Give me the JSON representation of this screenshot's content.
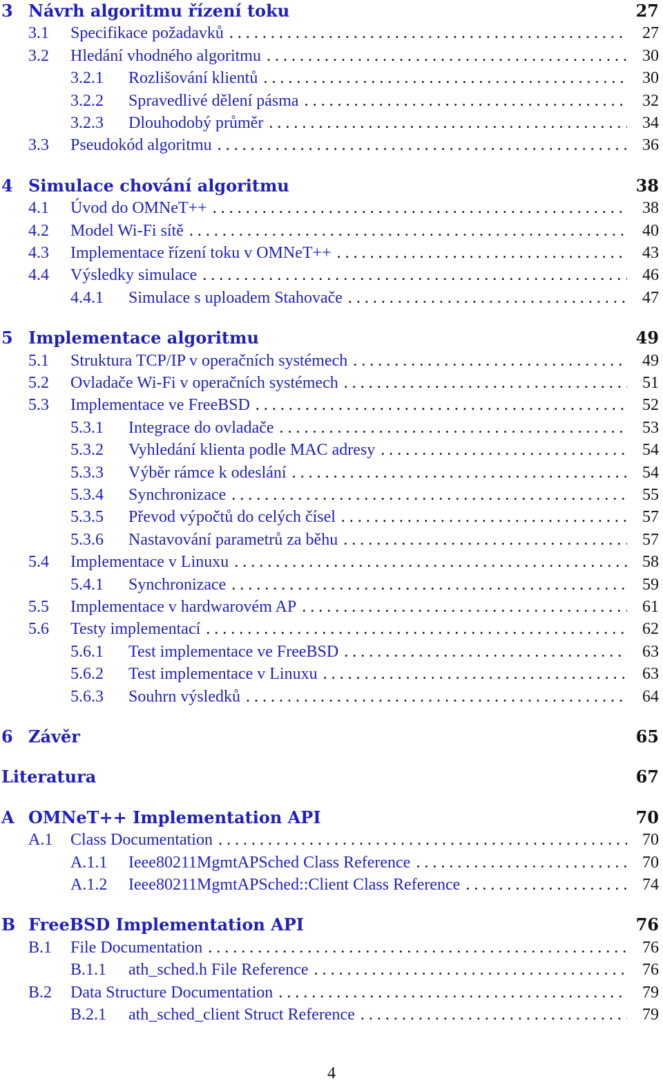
{
  "accent_color": "#1f1fbf",
  "entries": [
    {
      "level": "chapter",
      "num": "3",
      "title": "Návrh algoritmu řízení toku",
      "page": "27"
    },
    {
      "level": "section",
      "num": "3.1",
      "title": "Specifikace požadavků",
      "page": "27"
    },
    {
      "level": "section",
      "num": "3.2",
      "title": "Hledání vhodného algoritmu",
      "page": "30"
    },
    {
      "level": "subsection",
      "num": "3.2.1",
      "title": "Rozlišování klientů",
      "page": "30"
    },
    {
      "level": "subsection",
      "num": "3.2.2",
      "title": "Spravedlivé dělení pásma",
      "page": "32"
    },
    {
      "level": "subsection",
      "num": "3.2.3",
      "title": "Dlouhodobý průměr",
      "page": "34"
    },
    {
      "level": "section",
      "num": "3.3",
      "title": "Pseudokód algoritmu",
      "page": "36"
    },
    {
      "level": "chapter",
      "num": "4",
      "title": "Simulace chování algoritmu",
      "page": "38"
    },
    {
      "level": "section",
      "num": "4.1",
      "title": "Úvod do OMNeT++",
      "page": "38"
    },
    {
      "level": "section",
      "num": "4.2",
      "title": "Model Wi-Fi sítě",
      "page": "40"
    },
    {
      "level": "section",
      "num": "4.3",
      "title": "Implementace řízení toku v OMNeT++",
      "page": "43"
    },
    {
      "level": "section",
      "num": "4.4",
      "title": "Výsledky simulace",
      "page": "46"
    },
    {
      "level": "subsection",
      "num": "4.4.1",
      "title": "Simulace s uploadem Stahovače",
      "page": "47"
    },
    {
      "level": "chapter",
      "num": "5",
      "title": "Implementace algoritmu",
      "page": "49"
    },
    {
      "level": "section",
      "num": "5.1",
      "title": "Struktura TCP/IP v operačních systémech",
      "page": "49"
    },
    {
      "level": "section",
      "num": "5.2",
      "title": "Ovladače Wi-Fi v operačních systémech",
      "page": "51"
    },
    {
      "level": "section",
      "num": "5.3",
      "title": "Implementace ve FreeBSD",
      "page": "52"
    },
    {
      "level": "subsection",
      "num": "5.3.1",
      "title": "Integrace do ovladače",
      "page": "53"
    },
    {
      "level": "subsection",
      "num": "5.3.2",
      "title": "Vyhledání klienta podle MAC adresy",
      "page": "54"
    },
    {
      "level": "subsection",
      "num": "5.3.3",
      "title": "Výběr rámce k odeslání",
      "page": "54"
    },
    {
      "level": "subsection",
      "num": "5.3.4",
      "title": "Synchronizace",
      "page": "55"
    },
    {
      "level": "subsection",
      "num": "5.3.5",
      "title": "Převod výpočtů do celých čísel",
      "page": "57"
    },
    {
      "level": "subsection",
      "num": "5.3.6",
      "title": "Nastavování parametrů za běhu",
      "page": "57"
    },
    {
      "level": "section",
      "num": "5.4",
      "title": "Implementace v Linuxu",
      "page": "58"
    },
    {
      "level": "subsection",
      "num": "5.4.1",
      "title": "Synchronizace",
      "page": "59"
    },
    {
      "level": "section",
      "num": "5.5",
      "title": "Implementace v hardwarovém AP",
      "page": "61"
    },
    {
      "level": "section",
      "num": "5.6",
      "title": "Testy implementací",
      "page": "62"
    },
    {
      "level": "subsection",
      "num": "5.6.1",
      "title": "Test implementace ve FreeBSD",
      "page": "63"
    },
    {
      "level": "subsection",
      "num": "5.6.2",
      "title": "Test implementace v Linuxu",
      "page": "63"
    },
    {
      "level": "subsection",
      "num": "5.6.3",
      "title": "Souhrn výsledků",
      "page": "64"
    },
    {
      "level": "chapter",
      "num": "6",
      "title": "Závěr",
      "page": "65"
    },
    {
      "level": "chapter",
      "num": "",
      "title": "Literatura",
      "page": "67"
    },
    {
      "level": "chapter",
      "num": "A",
      "title": "OMNeT++ Implementation API",
      "page": "70"
    },
    {
      "level": "section",
      "num": "A.1",
      "title": "Class Documentation",
      "page": "70"
    },
    {
      "level": "subsection",
      "num": "A.1.1",
      "title": "Ieee80211MgmtAPSched Class Reference",
      "page": "70"
    },
    {
      "level": "subsection",
      "num": "A.1.2",
      "title": "Ieee80211MgmtAPSched::Client Class Reference",
      "page": "74"
    },
    {
      "level": "chapter",
      "num": "B",
      "title": "FreeBSD Implementation API",
      "page": "76"
    },
    {
      "level": "section",
      "num": "B.1",
      "title": "File Documentation",
      "page": "76"
    },
    {
      "level": "subsection",
      "num": "B.1.1",
      "title": "ath_sched.h File Reference",
      "page": "76"
    },
    {
      "level": "section",
      "num": "B.2",
      "title": "Data Structure Documentation",
      "page": "79"
    },
    {
      "level": "subsection",
      "num": "B.2.1",
      "title": "ath_sched_client Struct Reference",
      "page": "79"
    }
  ],
  "footer": {
    "page_number": "4"
  }
}
